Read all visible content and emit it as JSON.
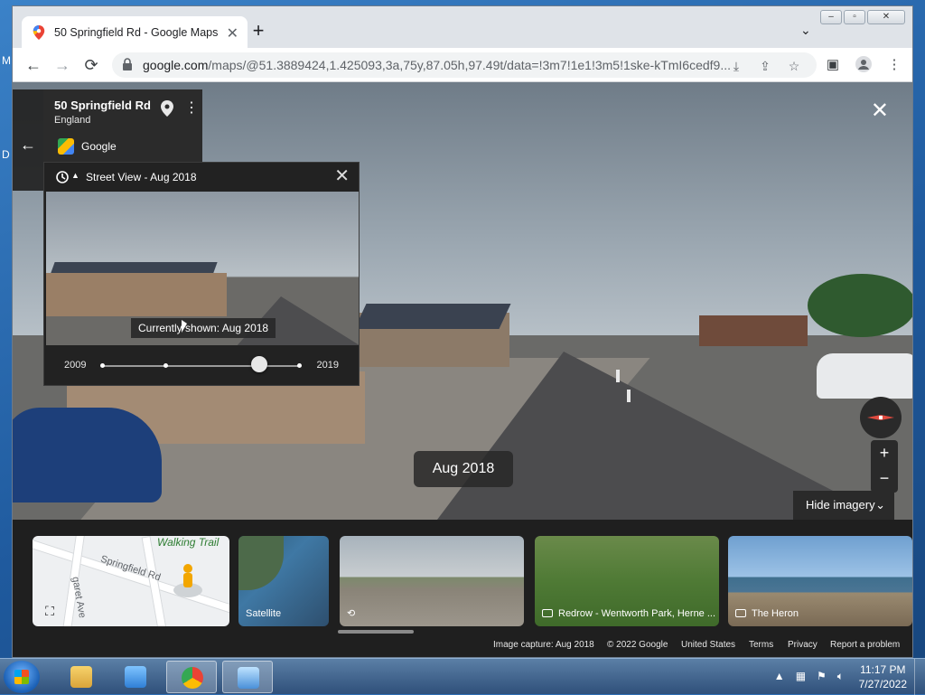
{
  "desktop": {
    "edge_letters": [
      "M",
      "D"
    ]
  },
  "browser": {
    "tab": {
      "title": "50 Springfield Rd - Google Maps",
      "close": "✕"
    },
    "newtab": "+",
    "tab_search": "⌄",
    "url_host": "google.com",
    "url_path": "/maps/@51.3889424,1.425093,3a,75y,87.05h,97.49t/data=!3m7!1e1!3m5!1ske-kTmI6cedf9...",
    "nav": {
      "back": "←",
      "forward": "→",
      "reload": "⟳"
    }
  },
  "placecard": {
    "title": "50 Springfield Rd",
    "subtitle": "England",
    "provider": "Google",
    "back": "←",
    "more": "⋮"
  },
  "timemachine": {
    "title": "Street View - Aug 2018",
    "close": "✕",
    "tooltip": "Currently shown: Aug 2018",
    "year_start": "2009",
    "year_end": "2019",
    "selected_fraction": 0.8
  },
  "streetview": {
    "close": "✕",
    "date_chip": "Aug 2018",
    "hide_imagery": "Hide imagery",
    "zoom_in": "+",
    "zoom_out": "−"
  },
  "strip": {
    "minimap": {
      "road_label": "Springfield Rd",
      "green_label": "Walking Trail",
      "street2": "garet Ave"
    },
    "satellite_label": "Satellite",
    "photo2_label": "Redrow - Wentworth Park, Herne ...",
    "photo3_label": "The Heron"
  },
  "footer": {
    "image_capture": "Image capture: Aug 2018",
    "copyright": "© 2022 Google",
    "country": "United States",
    "terms": "Terms",
    "privacy": "Privacy",
    "report": "Report a problem"
  },
  "taskbar": {
    "time": "11:17 PM",
    "date": "7/27/2022"
  }
}
